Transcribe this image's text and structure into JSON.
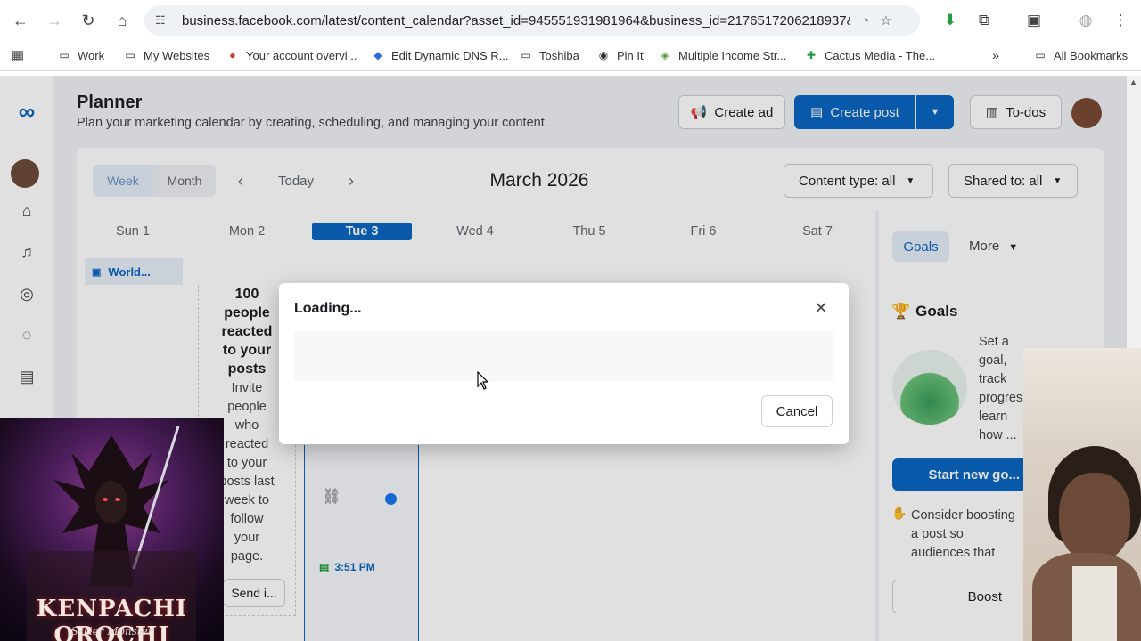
{
  "browser": {
    "url": "business.facebook.com/latest/content_calendar?asset_id=945551931981964&business_id=2176517206218937&...",
    "bookmarks": [
      {
        "label": "Work",
        "icon": "folder-icon"
      },
      {
        "label": "My Websites",
        "icon": "folder-icon"
      },
      {
        "label": "Your account overvi...",
        "icon": "site-icon"
      },
      {
        "label": "Edit Dynamic DNS R...",
        "icon": "site-icon"
      },
      {
        "label": "Toshiba",
        "icon": "folder-icon"
      },
      {
        "label": "Pin It",
        "icon": "globe-icon"
      },
      {
        "label": "Multiple Income Str...",
        "icon": "site-icon"
      },
      {
        "label": "Cactus Media - The...",
        "icon": "cactus-icon"
      }
    ],
    "all_bookmarks": "All Bookmarks"
  },
  "header": {
    "title": "Planner",
    "subtitle": "Plan your marketing calendar by creating, scheduling, and managing your content.",
    "create_ad": "Create ad",
    "create_post": "Create post",
    "todos": "To-dos"
  },
  "toolbar": {
    "week": "Week",
    "month": "Month",
    "today": "Today",
    "period": "March 2026",
    "content_type": "Content type: all",
    "shared_to": "Shared to: all"
  },
  "days": [
    "Sun 1",
    "Mon 2",
    "Tue 3",
    "Wed 4",
    "Thu 5",
    "Fri 6",
    "Sat 7"
  ],
  "calendar": {
    "event_chip": "World...",
    "reacted_text": "100 people reacted to your posts",
    "invite_text": "Invite people who reacted to your posts last week to follow your page.",
    "send_invite": "Send i...",
    "time": "3:51 PM"
  },
  "right_panel": {
    "tab_goals": "Goals",
    "tab_more": "More",
    "section_title": "Goals",
    "goal_text": "Set a goal, track progress, learn how ... for your professional success.",
    "start_goal": "Start new go...",
    "boost_text": "Consider boosting a post so audiences that follow you may see it.",
    "boost": "Boost"
  },
  "dialog": {
    "title": "Loading...",
    "cancel": "Cancel"
  },
  "stream": {
    "title": "KENPACHI OROCHI",
    "subtitle": "S-Tier Monster"
  },
  "colors": {
    "brand_blue": "#0a66c2",
    "page_bg": "#f0f2f5"
  }
}
